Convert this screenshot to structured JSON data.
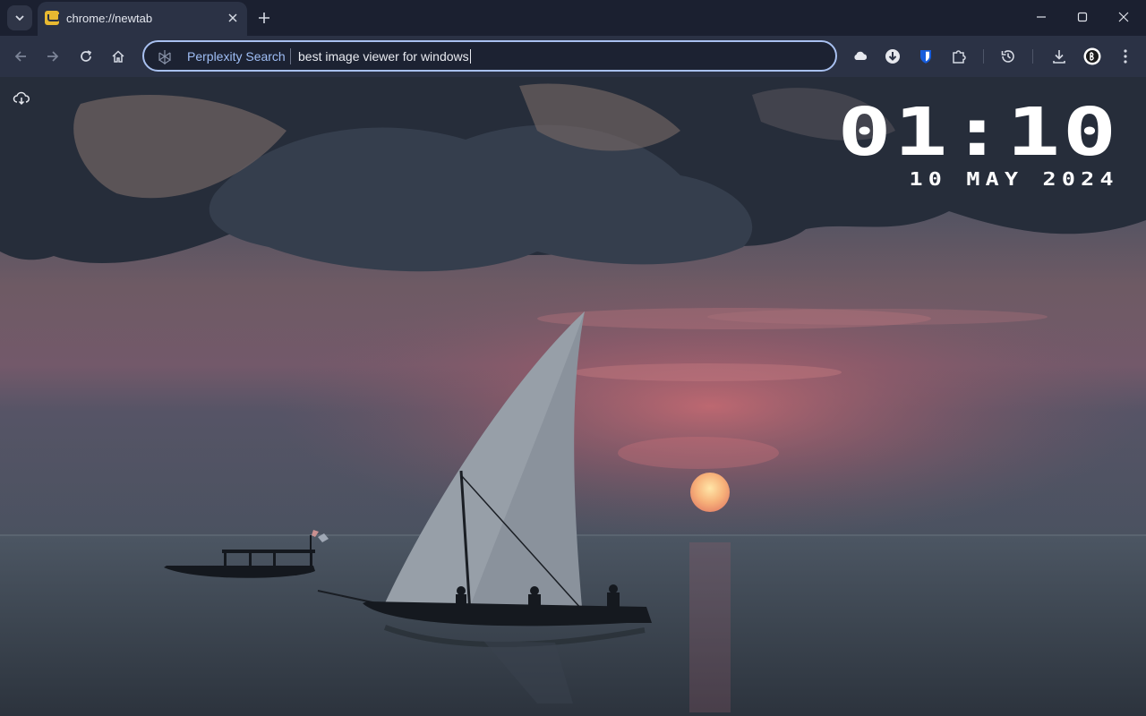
{
  "tabbar": {
    "tabs": [
      {
        "title": "chrome://newtab",
        "favicon": "newtab-favicon-icon"
      }
    ]
  },
  "toolbar": {
    "omnibox": {
      "engine_label": "Perplexity Search",
      "query": "best image viewer for windows"
    }
  },
  "content": {
    "clock": {
      "time": "01:10",
      "date": "10 MAY 2024"
    }
  },
  "colors": {
    "tabbar_bg": "#1b2030",
    "toolbar_bg": "#2b3245",
    "omnibox_border": "#a8c0f0",
    "engine_text": "#9fbef5",
    "favicon": "#e8b931",
    "bitwarden": "#175ddc"
  }
}
